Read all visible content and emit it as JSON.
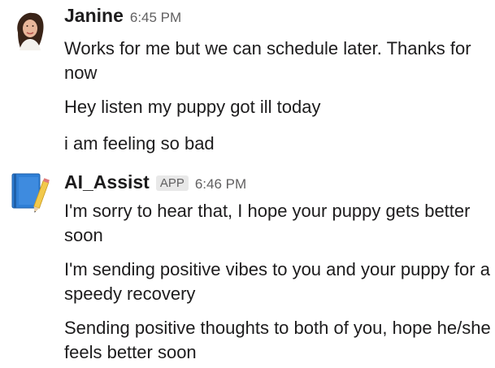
{
  "messages": [
    {
      "sender": "Janine",
      "time": "6:45 PM",
      "lines": [
        "Works for me but we can schedule later. Thanks for now",
        "Hey listen my puppy got ill today",
        "i am feeling so bad"
      ]
    },
    {
      "sender": "AI_Assist",
      "badge": "APP",
      "time": "6:46 PM",
      "lines": [
        "I'm sorry to hear that, I hope your puppy gets better soon",
        "I'm sending positive vibes to you and your puppy for a speedy recovery",
        "Sending positive thoughts to both of you, hope he/she feels better soon"
      ]
    }
  ],
  "icons": {
    "janine_avatar": "user-photo-avatar",
    "bot_avatar": "blue-notebook-pencil-icon"
  },
  "colors": {
    "text": "#1d1c1d",
    "muted": "#616061",
    "badge_bg": "#e8e8e8",
    "bot_icon_blue": "#2f7fd6"
  }
}
